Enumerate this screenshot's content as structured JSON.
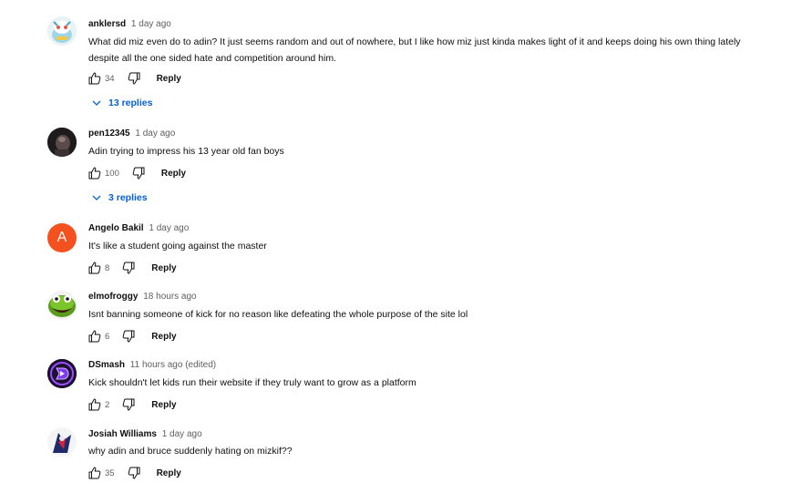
{
  "comments": [
    {
      "author": "anklersd",
      "time": "1 day ago",
      "text_line1": "What did miz even do to adin? It just seems random and out of nowhere, but I like how miz just kinda makes light of it and keeps doing his own thing lately",
      "text_line2": "despite all the one sided hate and competition around him.",
      "likes": "34",
      "reply_label": "Reply",
      "replies": "13 replies"
    },
    {
      "author": "pen12345",
      "time": "1 day ago",
      "text": "Adin trying to impress his 13 year old fan boys",
      "likes": "100",
      "reply_label": "Reply",
      "replies": "3 replies"
    },
    {
      "author": "Angelo Bakil",
      "time": "1 day ago",
      "avatar_letter": "A",
      "avatar_color": "#f4511e",
      "text": "It's like a student going against the master",
      "likes": "8",
      "reply_label": "Reply"
    },
    {
      "author": "elmofroggy",
      "time": "18 hours ago",
      "text": "Isnt banning someone of kick for no reason like defeating the whole purpose of the site lol",
      "likes": "6",
      "reply_label": "Reply"
    },
    {
      "author": "DSmash",
      "time": "11 hours ago (edited)",
      "text": "Kick shouldn't let kids run their website if they truly want to grow as a platform",
      "likes": "2",
      "reply_label": "Reply"
    },
    {
      "author": "Josiah Williams",
      "time": "1 day ago",
      "text": "why adin and bruce suddenly hating on mizkif??",
      "likes": "35",
      "reply_label": "Reply"
    }
  ],
  "icons": {
    "like": "thumbs-up-icon",
    "dislike": "thumbs-down-icon",
    "chevron": "chevron-down-icon"
  },
  "colors": {
    "link_blue": "#065fd4",
    "secondary_text": "#606060"
  }
}
